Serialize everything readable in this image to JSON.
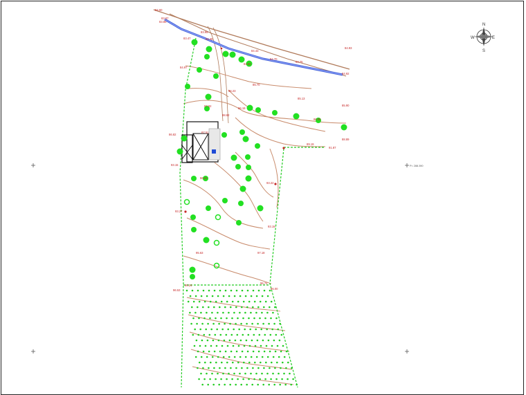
{
  "map": {
    "elevation_labels": [
      "84.60",
      "83.87",
      "83.86",
      "83.47",
      "83.95",
      "84.35",
      "84.43",
      "84.70",
      "84.75",
      "84.93",
      "84.92",
      "84.63",
      "84.97",
      "85.70",
      "86.23",
      "85.13",
      "85.90",
      "86.19",
      "86.06",
      "87.82",
      "88.82",
      "86.82",
      "87.51",
      "89.19",
      "88.89",
      "91.87",
      "93.15",
      "96.62",
      "93.22",
      "93.27",
      "93.19",
      "95.63",
      "97.18",
      "98.24",
      "96.74",
      "96.53",
      "95.00"
    ],
    "point_label": "P= 288.390",
    "compass": {
      "icon": "north-arrow-icon",
      "labels": [
        "N",
        "E",
        "S",
        "W"
      ]
    },
    "colors": {
      "boundary": "#22cc22",
      "tree": "#22e022",
      "contour": "#c88a6a",
      "road": "#b07a5a",
      "water": "#3b5bd6",
      "label": "#c62828",
      "building": "#111111"
    }
  }
}
